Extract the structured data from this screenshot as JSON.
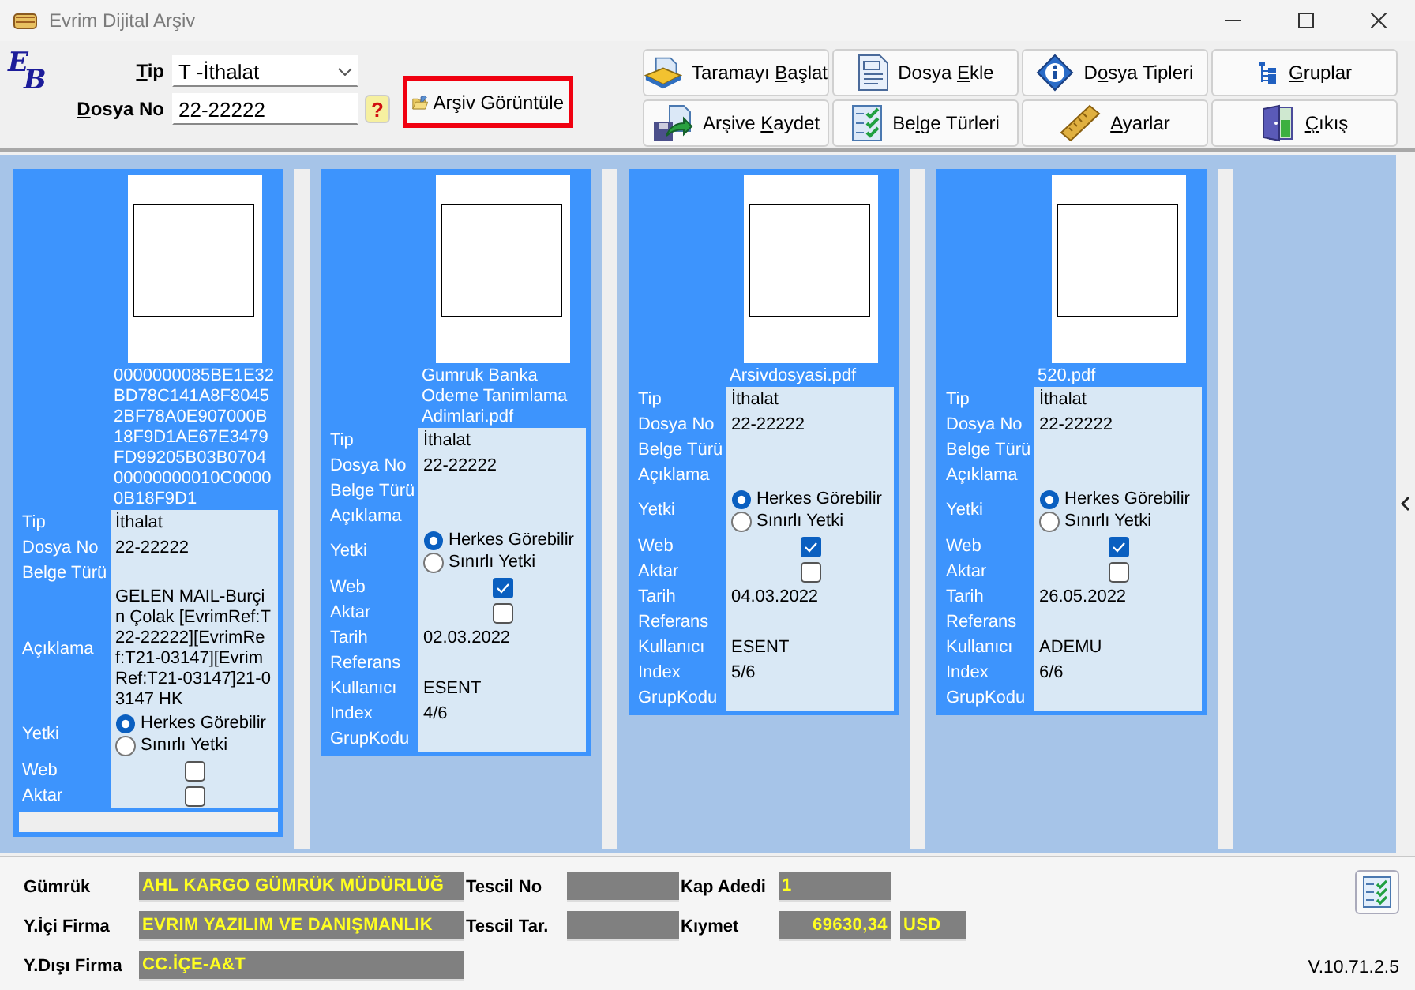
{
  "window": {
    "title": "Evrim Dijital Arşiv"
  },
  "logo_letters": [
    "E",
    "B"
  ],
  "search": {
    "tip": {
      "label": {
        "key": "T",
        "after": "ip"
      },
      "value": "T  -İthalat"
    },
    "dosya_no": {
      "label": {
        "key": "D",
        "after": "osya No"
      },
      "value": "22-22222"
    },
    "help": "?",
    "view_button": "Arşiv Görüntüle"
  },
  "toolbar": [
    {
      "label": {
        "before": "Taramayı ",
        "key": "B",
        "after": "aşlat"
      }
    },
    {
      "label": {
        "before": "Dosya ",
        "key": "E",
        "after": "kle"
      }
    },
    {
      "label": {
        "before": "D",
        "key": "o",
        "after": "sya Tipleri"
      }
    },
    {
      "label": {
        "key": "G",
        "after": "ruplar"
      }
    },
    {
      "label": {
        "before": "Arşive ",
        "key": "K",
        "after": "aydet"
      }
    },
    {
      "label": {
        "before": "Be",
        "key": "l",
        "after": "ge Türleri"
      }
    },
    {
      "label": {
        "key": "A",
        "after": "yarlar"
      }
    },
    {
      "label": {
        "key": "Ç",
        "after": "ıkış"
      }
    }
  ],
  "cards": [
    {
      "filename": "0000000085BE1E32BD78C141A8F80452BF78A0E907000B18F9D1AE67E3479FD99205B03B070400000000010C00000B18F9D1",
      "fields": [
        {
          "kind": "text",
          "label": "Tip",
          "value": "İthalat"
        },
        {
          "kind": "text",
          "label": "Dosya No",
          "value": "22-22222"
        },
        {
          "kind": "text",
          "label": "Belge Türü"
        },
        {
          "kind": "text",
          "label": "Açıklama",
          "value": "GELEN MAIL-Burçin Çolak [EvrimRef:T22-22222][EvrimRef:T21-03147][EvrimRef:T21-03147]21-03147 HK"
        },
        {
          "kind": "radio",
          "label": "Yetki",
          "options": [
            {
              "label": "Herkes Görebilir",
              "selected": true
            },
            {
              "label": "Sınırlı Yetki",
              "selected": false
            }
          ]
        },
        {
          "kind": "checkbox",
          "label": "Web",
          "checked": false
        },
        {
          "kind": "checkbox",
          "label": "Aktar",
          "checked": false
        }
      ],
      "scrollbar": true
    },
    {
      "filename": "Gumruk Banka Odeme Tanimlama Adimlari.pdf",
      "fields": [
        {
          "kind": "text",
          "label": "Tip",
          "value": "İthalat"
        },
        {
          "kind": "text",
          "label": "Dosya No",
          "value": "22-22222"
        },
        {
          "kind": "text",
          "label": "Belge Türü"
        },
        {
          "kind": "text",
          "label": "Açıklama"
        },
        {
          "kind": "radio",
          "label": "Yetki",
          "options": [
            {
              "label": "Herkes Görebilir",
              "selected": true
            },
            {
              "label": "Sınırlı Yetki",
              "selected": false
            }
          ]
        },
        {
          "kind": "checkbox",
          "label": "Web",
          "checked": true
        },
        {
          "kind": "checkbox",
          "label": "Aktar",
          "checked": false
        },
        {
          "kind": "text",
          "label": "Tarih",
          "value": "02.03.2022"
        },
        {
          "kind": "text",
          "label": "Referans"
        },
        {
          "kind": "text",
          "label": "Kullanıcı",
          "value": "ESENT"
        },
        {
          "kind": "text",
          "label": "Index",
          "value": "4/6"
        },
        {
          "kind": "text",
          "label": "GrupKodu"
        }
      ],
      "scrollbar": false
    },
    {
      "filename": "Arsivdosyasi.pdf",
      "fields": [
        {
          "kind": "text",
          "label": "Tip",
          "value": "İthalat"
        },
        {
          "kind": "text",
          "label": "Dosya No",
          "value": "22-22222"
        },
        {
          "kind": "text",
          "label": "Belge Türü"
        },
        {
          "kind": "text",
          "label": "Açıklama"
        },
        {
          "kind": "radio",
          "label": "Yetki",
          "options": [
            {
              "label": "Herkes Görebilir",
              "selected": true
            },
            {
              "label": "Sınırlı Yetki",
              "selected": false
            }
          ]
        },
        {
          "kind": "checkbox",
          "label": "Web",
          "checked": true
        },
        {
          "kind": "checkbox",
          "label": "Aktar",
          "checked": false
        },
        {
          "kind": "text",
          "label": "Tarih",
          "value": "04.03.2022"
        },
        {
          "kind": "text",
          "label": "Referans"
        },
        {
          "kind": "text",
          "label": "Kullanıcı",
          "value": "ESENT"
        },
        {
          "kind": "text",
          "label": "Index",
          "value": "5/6"
        },
        {
          "kind": "text",
          "label": "GrupKodu"
        }
      ],
      "scrollbar": false
    },
    {
      "filename": "520.pdf",
      "fields": [
        {
          "kind": "text",
          "label": "Tip",
          "value": "İthalat"
        },
        {
          "kind": "text",
          "label": "Dosya No",
          "value": "22-22222"
        },
        {
          "kind": "text",
          "label": "Belge Türü"
        },
        {
          "kind": "text",
          "label": "Açıklama"
        },
        {
          "kind": "radio",
          "label": "Yetki",
          "options": [
            {
              "label": "Herkes Görebilir",
              "selected": true
            },
            {
              "label": "Sınırlı Yetki",
              "selected": false
            }
          ]
        },
        {
          "kind": "checkbox",
          "label": "Web",
          "checked": true
        },
        {
          "kind": "checkbox",
          "label": "Aktar",
          "checked": false
        },
        {
          "kind": "text",
          "label": "Tarih",
          "value": "26.05.2022"
        },
        {
          "kind": "text",
          "label": "Referans"
        },
        {
          "kind": "text",
          "label": "Kullanıcı",
          "value": "ADEMU"
        },
        {
          "kind": "text",
          "label": "Index",
          "value": "6/6"
        },
        {
          "kind": "text",
          "label": "GrupKodu"
        }
      ],
      "scrollbar": false
    }
  ],
  "footer": {
    "rows": [
      [
        {
          "label": "Gümrük",
          "values": [
            "AHL KARGO GÜMRÜK MÜDÜRLÜĞ"
          ]
        },
        {
          "label": "Tescil No"
        },
        {
          "label": "Kap Adedi",
          "values": [
            "1"
          ]
        }
      ],
      [
        {
          "label": "Y.İçi Firma",
          "values": [
            "EVRIM YAZILIM VE DANIŞMANLIK"
          ]
        },
        {
          "label": "Tescil Tar."
        },
        {
          "label": "Kıymet",
          "values": [
            "69630,34",
            "USD"
          ]
        }
      ],
      [
        {
          "label": "Y.Dışı Firma",
          "values": [
            "CC.İÇE-A&T"
          ]
        }
      ]
    ],
    "version": "V.10.71.2.5"
  }
}
